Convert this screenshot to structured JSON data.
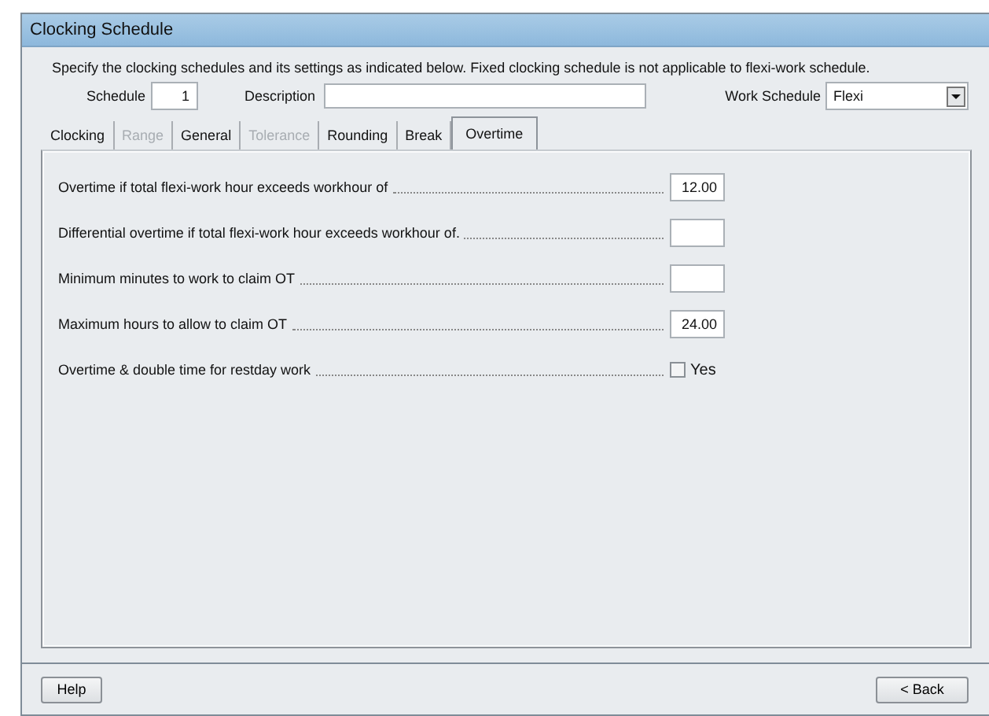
{
  "window": {
    "title": "Clocking Schedule"
  },
  "instructions": "Specify the clocking schedules and its settings as indicated below. Fixed clocking schedule is not applicable to flexi-work schedule.",
  "header": {
    "schedule_label": "Schedule",
    "schedule_value": "1",
    "description_label": "Description",
    "work_schedule_label": "Work Schedule",
    "work_schedule_value": "Flexi"
  },
  "tabs": [
    {
      "label": "Clocking",
      "selected": false,
      "disabled": false
    },
    {
      "label": "Range",
      "selected": false,
      "disabled": true
    },
    {
      "label": "General",
      "selected": false,
      "disabled": false
    },
    {
      "label": "Tolerance",
      "selected": false,
      "disabled": true
    },
    {
      "label": "Rounding",
      "selected": false,
      "disabled": false
    },
    {
      "label": "Break",
      "selected": false,
      "disabled": false
    },
    {
      "label": "Overtime",
      "selected": true,
      "disabled": false
    }
  ],
  "settings": [
    {
      "kind": "text",
      "label": "Overtime if total flexi-work hour exceeds workhour of",
      "value": "12.00"
    },
    {
      "kind": "text",
      "label": "Differential overtime if total flexi-work hour exceeds workhour of."
    },
    {
      "kind": "text",
      "label": "Minimum minutes to work to claim OT"
    },
    {
      "kind": "text",
      "label": "Maximum hours to allow to claim OT",
      "value": "24.00"
    },
    {
      "kind": "checkbox",
      "label": "Overtime & double time for restday work",
      "option": "Yes",
      "checked": false
    }
  ],
  "buttons": {
    "help": "Help",
    "back": "< Back"
  }
}
